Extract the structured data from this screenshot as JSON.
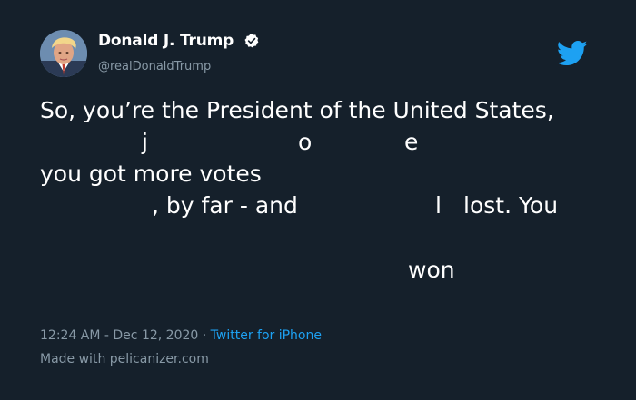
{
  "author": {
    "name": "Donald J. Trump",
    "handle": "@realDonaldTrump"
  },
  "tweet": {
    "line1": "So, you’re the President of the United States,",
    "frag_j": "j",
    "frag_o": "o",
    "frag_e": "e",
    "line3": "you got more votes",
    "frag_by_far": ", by far - and",
    "frag_l": "l",
    "frag_lost": "lost. You",
    "frag_won": "won"
  },
  "meta": {
    "time": "12:24 AM - Dec 12, 2020",
    "separator": " · ",
    "source": "Twitter for iPhone"
  },
  "footer": {
    "made_with": "Made with pelicanizer.com"
  },
  "colors": {
    "background": "#15202b",
    "text": "#ffffff",
    "secondary": "#8899a6",
    "accent": "#1da1f2"
  },
  "icons": [
    "verified-badge-icon",
    "twitter-bird-icon"
  ]
}
